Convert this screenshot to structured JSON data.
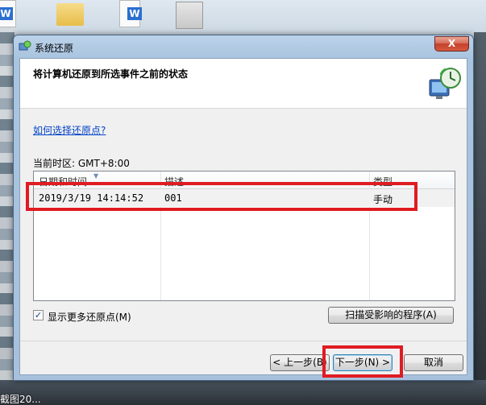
{
  "window": {
    "title": "系统还原",
    "close_label": "X"
  },
  "header": {
    "heading": "将计算机还原到所选事件之前的状态"
  },
  "help_link": "如何选择还原点?",
  "timezone": "当前时区: GMT+8:00",
  "table": {
    "columns": [
      "日期和时间",
      "描述",
      "类型"
    ],
    "rows": [
      {
        "datetime": "2019/3/19 14:14:52",
        "description": "001",
        "type": "手动"
      }
    ]
  },
  "show_more": {
    "label": "显示更多还原点(M)",
    "checked": true
  },
  "buttons": {
    "scan": "扫描受影响的程序(A)",
    "back": "< 上一步(B)",
    "next": "下一步(N) >",
    "cancel": "取消"
  },
  "desktop": {
    "bottom_label": "截图20..."
  },
  "colors": {
    "annotation": "#e01b22",
    "link": "#0645c8",
    "close": "#c4402b"
  }
}
